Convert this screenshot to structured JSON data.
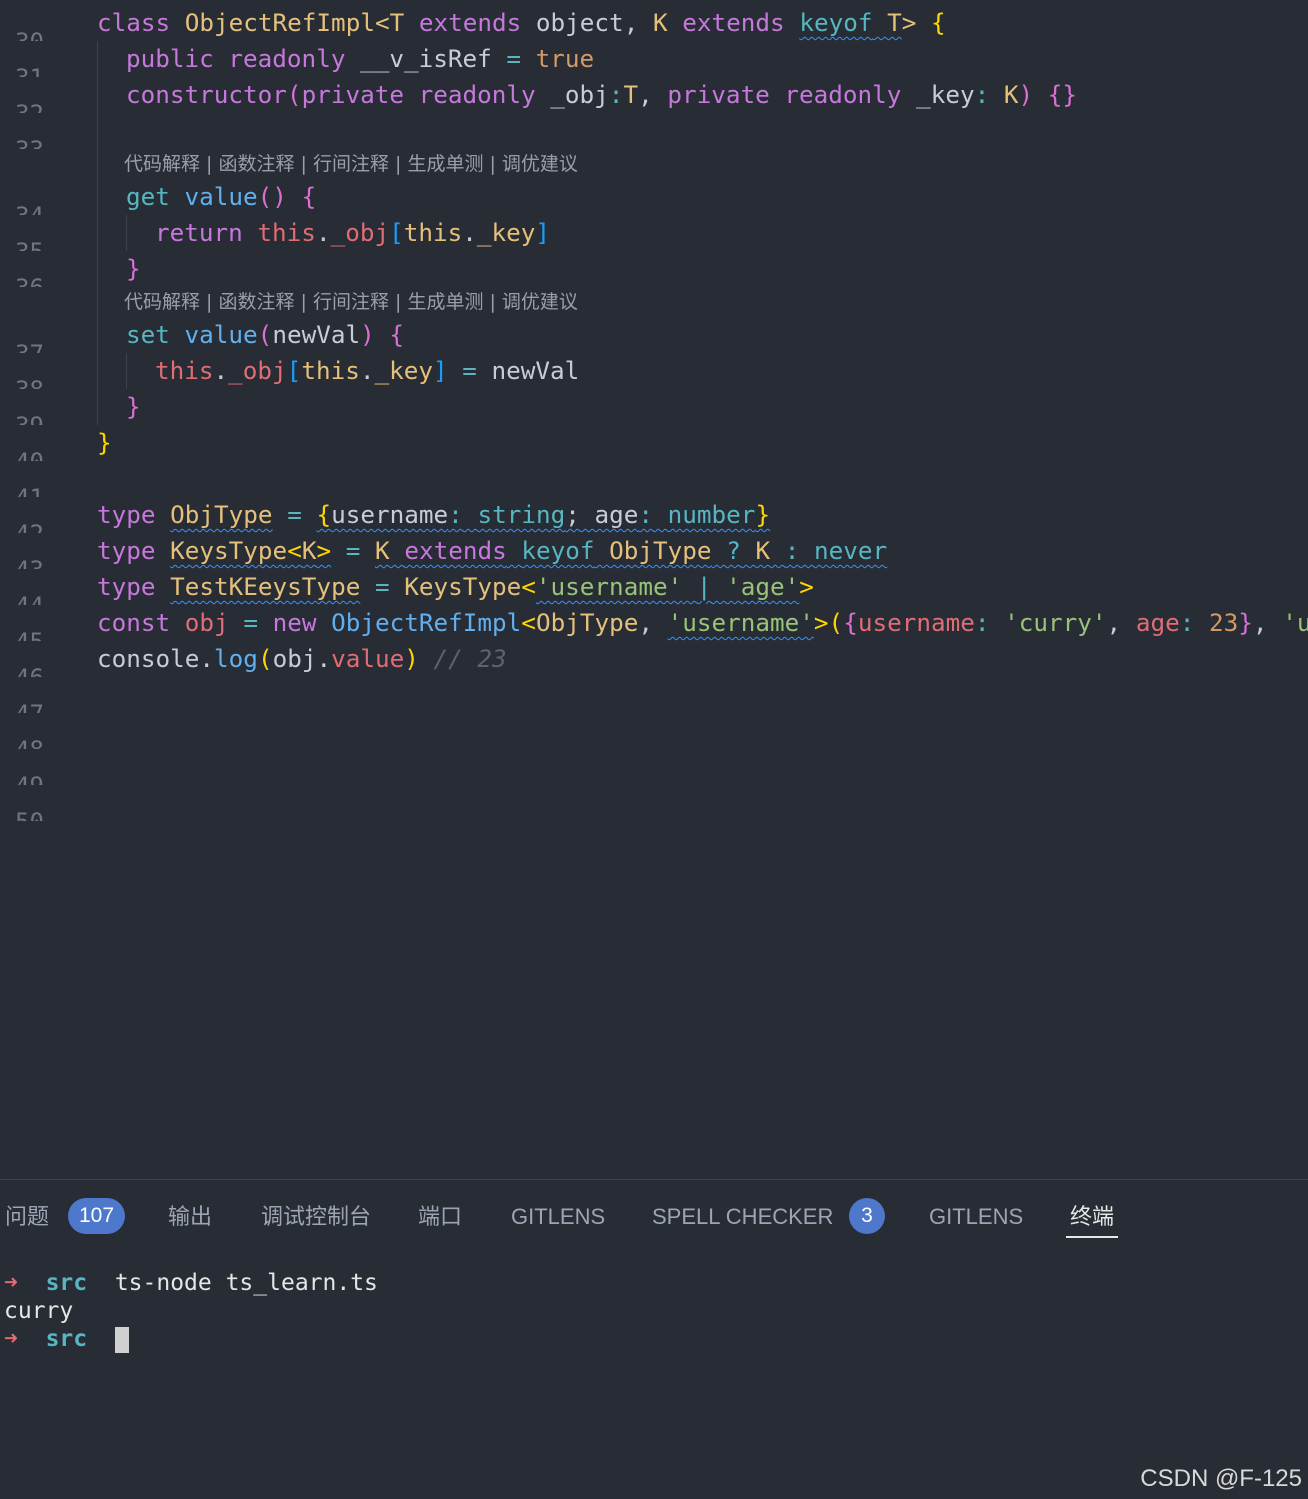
{
  "editor": {
    "line_numbers": [
      "30",
      "31",
      "32",
      "33",
      "34",
      "35",
      "36",
      "37",
      "38",
      "39",
      "40",
      "41",
      "42",
      "43",
      "44",
      "45",
      "46",
      "47",
      "48",
      "49",
      "50"
    ],
    "codelens": "代码解释 | 函数注释 | 行间注释 | 生成单测 | 调优建议",
    "tokens": {
      "class": "class",
      "ObjectRefImpl": "ObjectRefImpl",
      "lt": "<",
      "gt": ">",
      "T": "T",
      "extends": "extends",
      "object": "object",
      "comma": ",",
      "K": "K",
      "keyof": "keyof",
      "lbrace": "{",
      "rbrace": "}",
      "public": "public",
      "readonly": "readonly",
      "v_isRef": "__v_isRef",
      "eq": "=",
      "true": "true",
      "constructor": "constructor",
      "lparen": "(",
      "rparen": ")",
      "private": "private",
      "_obj": "_obj",
      "colon": ":",
      "_key": "_key",
      "emptyobj": "{}",
      "get": "get",
      "set": "set",
      "value": "value",
      "parens": "()",
      "return": "return",
      "this": "this",
      "dot": ".",
      "lbr": "[",
      "rbr": "]",
      "newVal": "newVal",
      "type": "type",
      "ObjType": "ObjType",
      "username": "username",
      "string": "string",
      "semi": ";",
      "age": "age",
      "number": "number",
      "KeysType": "KeysType",
      "q": "?",
      "never": "never",
      "TestKEeysType": "TestKEeysType",
      "str_username": "'username'",
      "pipe": "|",
      "str_age": "'age'",
      "const": "const",
      "obj": "obj",
      "new": "new",
      "str_curry": "'curry'",
      "n23": "23",
      "str_us": "'us",
      "console": "console",
      "log": "log",
      "comment": "// 23"
    }
  },
  "panel": {
    "tabs": [
      "问题",
      "输出",
      "调试控制台",
      "端口",
      "GITLENS",
      "SPELL CHECKER",
      "GITLENS",
      "终端"
    ],
    "problems_count": "107",
    "spell_count": "3",
    "active_tab": "终端"
  },
  "terminal": {
    "prompt_arrow": "➜",
    "dir": "src",
    "command": "ts-node ts_learn.ts",
    "output": "curry"
  },
  "watermark": "CSDN @F-125",
  "colors": {
    "background": "#282c34",
    "keyword": "#c678dd",
    "type": "#e5c07b",
    "function": "#61afef",
    "string": "#98c379",
    "property": "#e06c75",
    "number": "#d19a66",
    "badge": "#4d78cc"
  }
}
